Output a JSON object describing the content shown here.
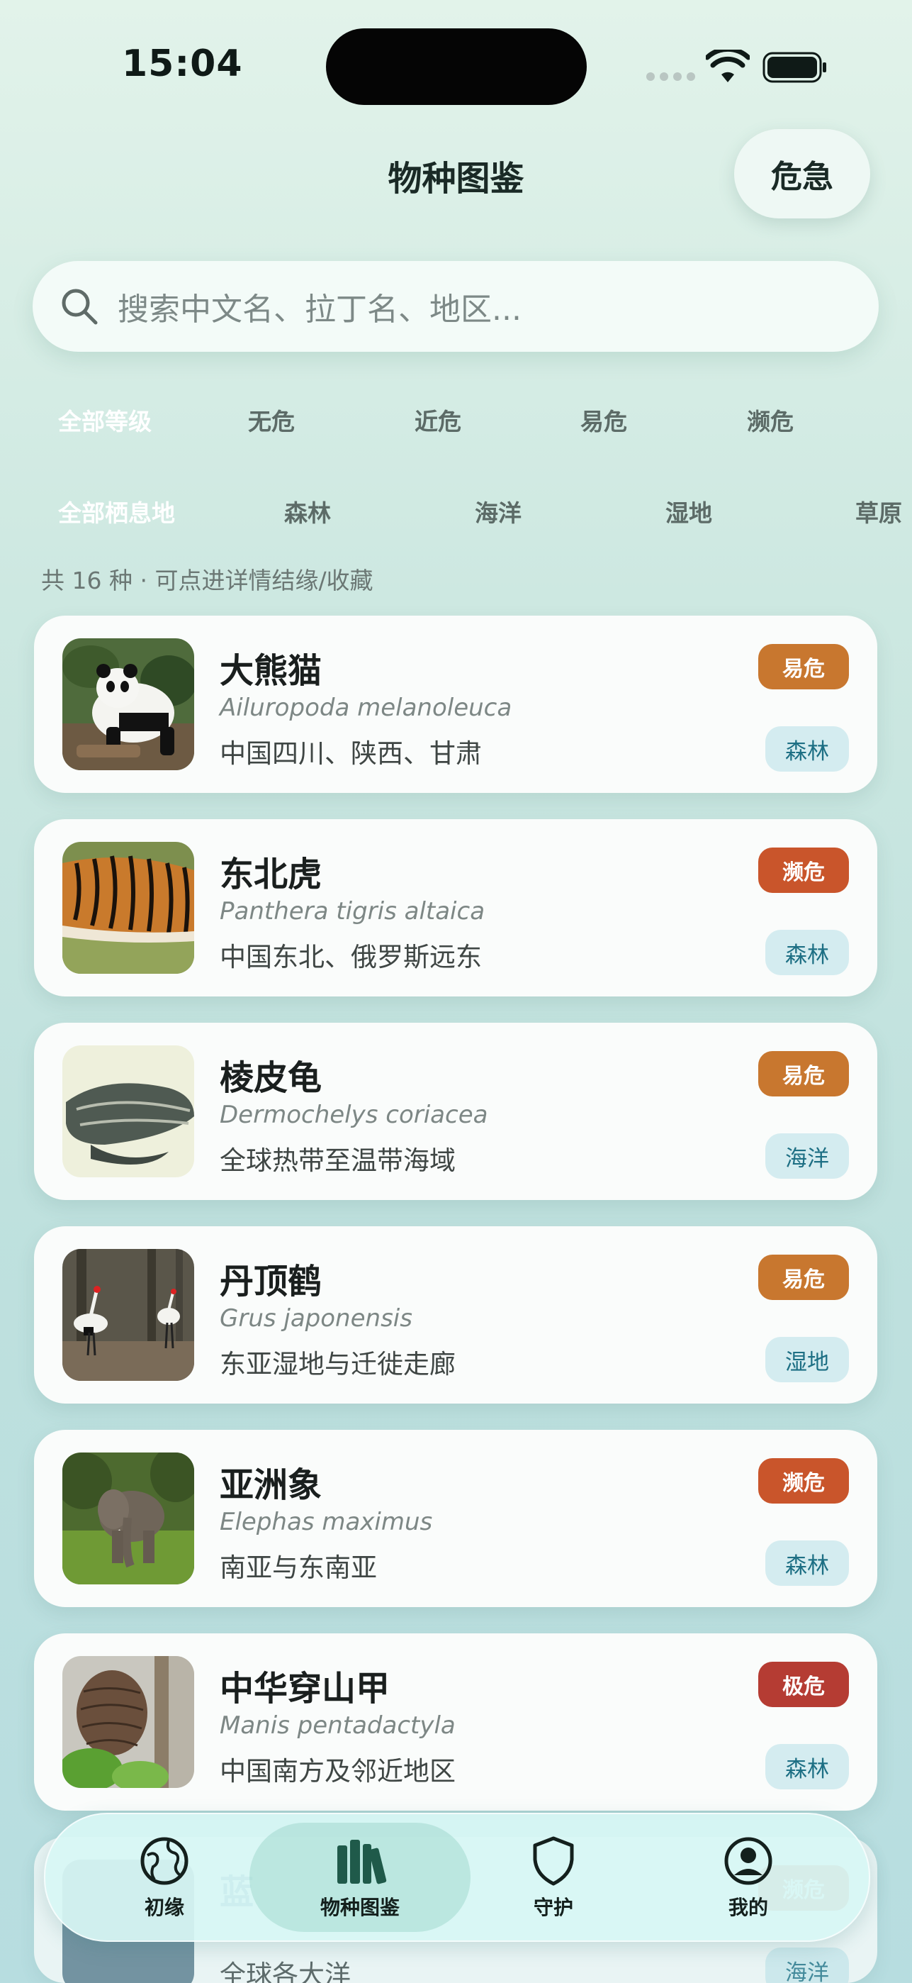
{
  "status_bar": {
    "time": "15:04"
  },
  "header": {
    "title": "物种图鉴",
    "danger_button": "危急"
  },
  "search": {
    "placeholder": "搜索中文名、拉丁名、地区..."
  },
  "filters": {
    "levels": [
      "全部等级",
      "无危",
      "近危",
      "易危",
      "濒危"
    ],
    "habitats": [
      "全部栖息地",
      "森林",
      "海洋",
      "湿地",
      "草原"
    ]
  },
  "summary": "共 16 种 · 可点进详情结缘/收藏",
  "species": [
    {
      "name": "大熊猫",
      "latin": "Ailuropoda melanoleuca",
      "region": "中国四川、陕西、甘肃",
      "status": "易危",
      "habitat": "森林",
      "status_color": "#c8772f"
    },
    {
      "name": "东北虎",
      "latin": "Panthera tigris altaica",
      "region": "中国东北、俄罗斯远东",
      "status": "濒危",
      "habitat": "森林",
      "status_color": "#c9552b"
    },
    {
      "name": "棱皮龟",
      "latin": "Dermochelys coriacea",
      "region": "全球热带至温带海域",
      "status": "易危",
      "habitat": "海洋",
      "status_color": "#c8772f"
    },
    {
      "name": "丹顶鹤",
      "latin": "Grus japonensis",
      "region": "东亚湿地与迁徙走廊",
      "status": "易危",
      "habitat": "湿地",
      "status_color": "#c8772f"
    },
    {
      "name": "亚洲象",
      "latin": "Elephas maximus",
      "region": "南亚与东南亚",
      "status": "濒危",
      "habitat": "森林",
      "status_color": "#c9552b"
    },
    {
      "name": "中华穿山甲",
      "latin": "Manis pentadactyla",
      "region": "中国南方及邻近地区",
      "status": "极危",
      "habitat": "森林",
      "status_color": "#b53c33"
    },
    {
      "name": "蓝",
      "latin": "",
      "region": "全球各大洋",
      "status": "濒危",
      "habitat": "海洋",
      "status_color": "#c9552b"
    }
  ],
  "tabbar": {
    "items": [
      "初缘",
      "物种图鉴",
      "守护",
      "我的"
    ],
    "active": "物种图鉴"
  },
  "colors": {
    "accent_tab": "#1f5a4a",
    "habitat_badge_bg": "#d4ecf0",
    "habitat_badge_text": "#1d6f84"
  }
}
